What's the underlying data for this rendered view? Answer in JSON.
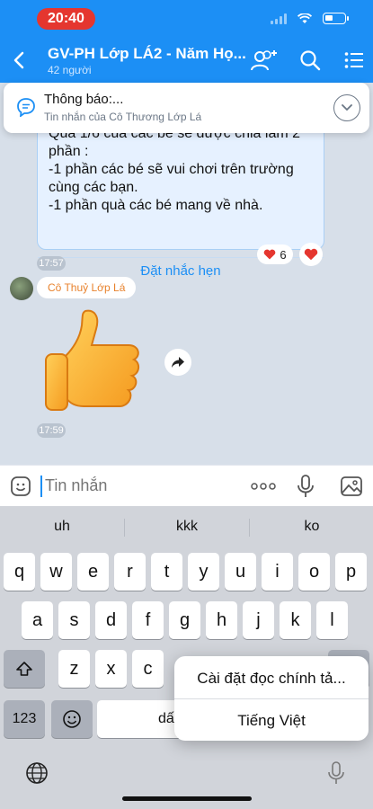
{
  "status": {
    "time": "20:40"
  },
  "header": {
    "title": "GV-PH Lớp LÁ2 - Năm Họ...",
    "members": "42 người"
  },
  "notice": {
    "title": "Thông báo:...",
    "subtitle": "Tin nhắn của Cô Thương Lớp Lá"
  },
  "messages": {
    "card_text": "Quà 1/6 của các bé sẽ được chia làm 2 phần :\n-1 phần các bé sẽ vui chơi trên trường cùng các bạn.\n-1 phần quà các bé mang về nhà.",
    "remind_label": "Đặt nhắc hẹn",
    "reaction_count": "6",
    "time1": "17:57",
    "sender": "Cô Thuỷ Lớp Lá",
    "time2": "17:59"
  },
  "input": {
    "placeholder": "Tin nhắn"
  },
  "keyboard": {
    "suggestions": [
      "uh",
      "kkk",
      "ko"
    ],
    "row1": [
      "q",
      "w",
      "e",
      "r",
      "t",
      "y",
      "u",
      "i",
      "o",
      "p"
    ],
    "row2": [
      "a",
      "s",
      "d",
      "f",
      "g",
      "h",
      "j",
      "k",
      "l"
    ],
    "row3": [
      "z",
      "x",
      "c"
    ],
    "num_key": "123",
    "space_partial": "dấ"
  },
  "popup": {
    "item1": "Cài đặt đọc chính tả...",
    "item2": "Tiếng Việt"
  },
  "colors": {
    "accent": "#1c8ff5",
    "status_red": "#e5362f",
    "sender_orange": "#e8822d"
  }
}
